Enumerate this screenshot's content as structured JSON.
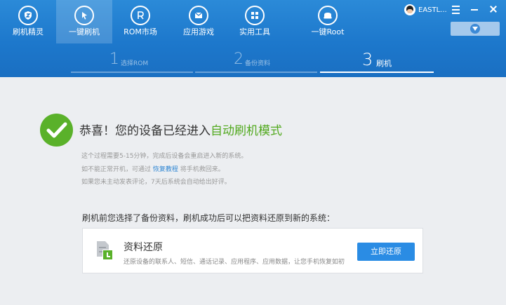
{
  "nav": {
    "items": [
      {
        "label": "刷机精灵",
        "icon": "shield-icon",
        "active": false
      },
      {
        "label": "一键刷机",
        "icon": "cursor-icon",
        "active": true
      },
      {
        "label": "ROM市场",
        "icon": "rom-icon",
        "active": false
      },
      {
        "label": "应用游戏",
        "icon": "message-icon",
        "active": false
      },
      {
        "label": "实用工具",
        "icon": "grid-icon",
        "active": false
      },
      {
        "label": "一键Root",
        "icon": "root-icon",
        "active": false
      }
    ]
  },
  "user": {
    "name": "EASTL..."
  },
  "window_controls": [
    "menu-icon",
    "minimize-icon",
    "close-icon"
  ],
  "steps": [
    {
      "num": "1",
      "label": "选择ROM",
      "active": false
    },
    {
      "num": "2",
      "label": "备份资料",
      "active": false
    },
    {
      "num": "3",
      "label": "刷机",
      "active": true
    }
  ],
  "main": {
    "title_prefix": "恭喜！您的设备已经进入",
    "title_highlight": "自动刷机模式",
    "desc1": "这个过程需要5-15分钟，完成后设备会重启进入新的系统。",
    "desc2_prefix": "如不能正常开机，可通过",
    "desc2_link": "恢复教程",
    "desc2_suffix": "将手机救回来。",
    "desc3": "如果您未主动发表评论，7天后系统会自动给出好评。",
    "subtitle": "刷机前您选择了备份资料，刷机成功后可以把资料还原到新的系统：",
    "card": {
      "title": "资料还原",
      "desc": "还原设备的联系人、短信、通话记录、应用程序、应用数据，让您手机恢复如初",
      "button": "立即还原"
    }
  },
  "colors": {
    "header_blue": "#1d78cc",
    "accent_green": "#5ab12a",
    "link_blue": "#2f86d3",
    "button_blue": "#2a8ce4"
  }
}
